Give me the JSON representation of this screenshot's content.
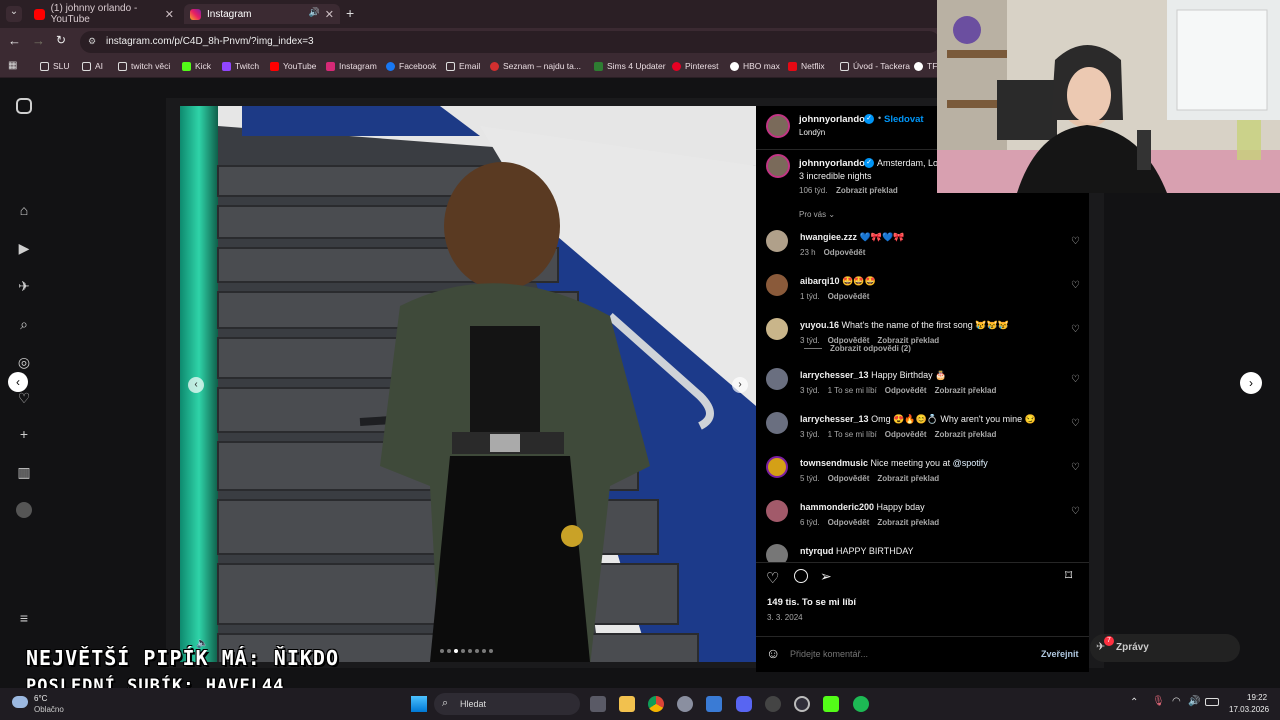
{
  "tabs": [
    {
      "label": "(1) johnny orlando - YouTube",
      "favicon": "youtube-icon",
      "active": false
    },
    {
      "label": "Instagram",
      "favicon": "instagram-icon",
      "active": true
    }
  ],
  "address": {
    "url": "instagram.com/p/C4D_8h-Pnvm/?img_index=3"
  },
  "bookmarks": [
    {
      "label": "SLU"
    },
    {
      "label": "AI"
    },
    {
      "label": "twitch věci"
    },
    {
      "label": "Kick"
    },
    {
      "label": "Twitch"
    },
    {
      "label": "YouTube"
    },
    {
      "label": "Instagram"
    },
    {
      "label": "Facebook"
    },
    {
      "label": "Email"
    },
    {
      "label": "Seznam – najdu ta..."
    },
    {
      "label": "Sims 4 Updater"
    },
    {
      "label": "Pinterest"
    },
    {
      "label": "HBO max"
    },
    {
      "label": "Netflix"
    },
    {
      "label": "Úvod - Tackera"
    },
    {
      "label": "TF"
    }
  ],
  "post": {
    "author": "johnnyorlando",
    "follow_label": "Sledovat",
    "location": "Londýn",
    "caption_author": "johnnyorlando",
    "caption_text": "Amsterdam, Lo",
    "caption_line2": "3 incredible nights",
    "caption_age": "106 týd.",
    "caption_translate": "Zobrazit překlad",
    "sort_label": "Pro vás",
    "likes": "149 tis. To se mi líbí",
    "date": "3. 3. 2024",
    "comment_placeholder": "Přidejte komentář...",
    "publish_label": "Zveřejnit",
    "messages_label": "Zprávy",
    "messages_badge": "7",
    "carousel_dots": 8,
    "carousel_active": 2
  },
  "comments": [
    {
      "user": "hwangiee.zzz",
      "text": "💙🎀💙🎀",
      "age": "23 h",
      "likes": "",
      "reply": "Odpovědět",
      "translate": ""
    },
    {
      "user": "aibarqi10",
      "text": "🤩🤩🤩",
      "age": "1 týd.",
      "likes": "",
      "reply": "Odpovědět",
      "translate": ""
    },
    {
      "user": "yuyou.16",
      "text": "What's the name of the first song 😿😿😿",
      "age": "3 týd.",
      "likes": "",
      "reply": "Odpovědět",
      "translate": "Zobrazit překlad"
    },
    {
      "user": "larrychesser_13",
      "text": "Happy Birthday 🎂",
      "age": "3 týd.",
      "likes": "1 To se mi líbí",
      "reply": "Odpovědět",
      "translate": "Zobrazit překlad"
    },
    {
      "user": "larrychesser_13",
      "text": "Omg 😍🔥😊💍 Why aren't you mine 😏",
      "age": "3 týd.",
      "likes": "1 To se mi líbí",
      "reply": "Odpovědět",
      "translate": "Zobrazit překlad"
    },
    {
      "user": "townsendmusic",
      "text": "Nice meeting you at ",
      "mention": "@spotify",
      "age": "5 týd.",
      "likes": "",
      "reply": "Odpovědět",
      "translate": "Zobrazit překlad"
    },
    {
      "user": "hammonderic200",
      "text": "Happy bday",
      "age": "6 týd.",
      "likes": "",
      "reply": "Odpovědět",
      "translate": "Zobrazit překlad"
    },
    {
      "user": "ntyrqud",
      "text": "HAPPY BIRTHDAY",
      "age": "",
      "likes": "",
      "reply": "",
      "translate": ""
    }
  ],
  "view_replies": "Zobrazit odpovědi (2)",
  "overlay": {
    "line1": "NEJVĚTŠÍ PIPÍK MÁ: ŇIKDO",
    "line2": "POSLEDNÍ SUBÍK: HAVEL44"
  },
  "taskbar": {
    "weather_temp": "6°C",
    "weather_desc": "Oblačno",
    "search_label": "Hledat",
    "time": "19:22",
    "date": "17.03.2026"
  },
  "colors": {
    "accent_blue": "#0095f6",
    "tab_bar": "#2b1f25",
    "nav_bar": "#3b2a32",
    "page_bg": "#121214"
  }
}
